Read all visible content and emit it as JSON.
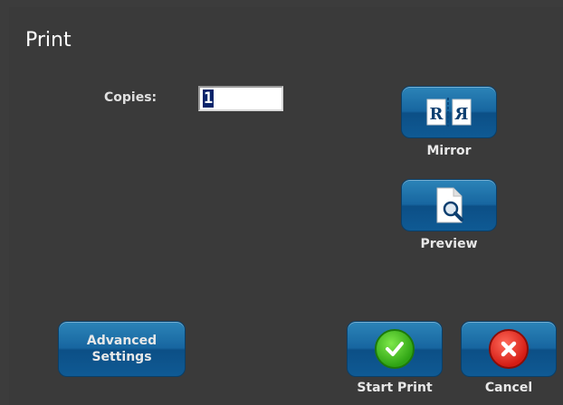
{
  "dialog": {
    "title": "Print"
  },
  "copies": {
    "label": "Copies:",
    "value": "1"
  },
  "buttons": {
    "mirror": {
      "label": "Mirror",
      "icon": "mirror-icon"
    },
    "preview": {
      "label": "Preview",
      "icon": "preview-icon"
    },
    "advanced": {
      "line1": "Advanced",
      "line2": "Settings"
    },
    "start_print": {
      "label": "Start Print",
      "icon": "check-icon"
    },
    "cancel": {
      "label": "Cancel",
      "icon": "close-icon"
    }
  },
  "colors": {
    "background": "#3a3a3a",
    "button_blue": "#1766a0",
    "check_green": "#2fa414",
    "cancel_red": "#d41c14"
  }
}
